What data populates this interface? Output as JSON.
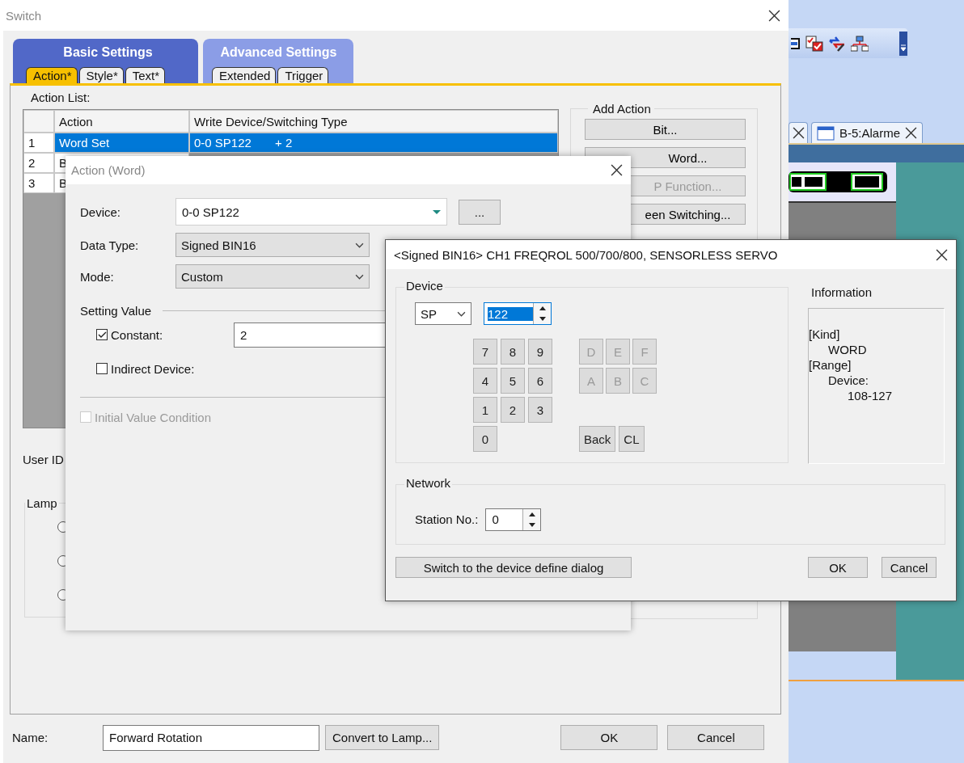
{
  "switch_window": {
    "title": "Switch",
    "tab_groups": [
      {
        "label": "Basic Settings",
        "selected": true,
        "tabs": [
          {
            "label": "Action*",
            "selected": true
          },
          {
            "label": "Style*",
            "selected": false
          },
          {
            "label": "Text*",
            "selected": false
          }
        ]
      },
      {
        "label": "Advanced Settings",
        "selected": false,
        "tabs": [
          {
            "label": "Extended",
            "selected": false
          },
          {
            "label": "Trigger",
            "selected": false
          }
        ]
      }
    ],
    "action_list": {
      "label": "Action List:",
      "columns": [
        "Action",
        "Write Device/Switching Type"
      ],
      "rows": [
        {
          "index": "1",
          "action": "Word Set",
          "target": "0-0 SP122       + 2",
          "selected": true
        },
        {
          "index": "2",
          "action": "B",
          "selected": false
        },
        {
          "index": "3",
          "action": "B",
          "selected": false
        }
      ]
    },
    "add_action": {
      "label": "Add Action",
      "buttons": [
        {
          "label": "Bit...",
          "disabled": false
        },
        {
          "label": "Word...",
          "disabled": false
        },
        {
          "label": "P Function...",
          "disabled": true
        },
        {
          "label": "een Switching...",
          "disabled": false
        }
      ]
    },
    "user_id_label": "User ID",
    "lamp_group": {
      "label": "Lamp"
    },
    "name": {
      "label": "Name:",
      "value": "Forward Rotation"
    },
    "buttons": [
      "Convert to Lamp...",
      "OK",
      "Cancel"
    ]
  },
  "action_dialog": {
    "title": "Action (Word)",
    "device": {
      "label": "Device:",
      "value": "0-0 SP122",
      "browse": "..."
    },
    "data_type": {
      "label": "Data Type:",
      "value": "Signed BIN16"
    },
    "mode": {
      "label": "Mode:",
      "value": "Custom"
    },
    "setting_value": {
      "label": "Setting Value",
      "options": [
        {
          "label": "Constant:",
          "checked": true,
          "value": "2"
        },
        {
          "label": "Indirect Device:",
          "checked": false
        }
      ]
    },
    "initial_value_condition": {
      "label": "Initial Value Condition",
      "checked": false,
      "disabled": true
    }
  },
  "device_dialog": {
    "title": "<Signed BIN16> CH1 FREQROL 500/700/800, SENSORLESS SERVO",
    "device_group": {
      "label": "Device",
      "device_type": "SP",
      "number": "122",
      "digit_keys": [
        "7",
        "8",
        "9",
        "4",
        "5",
        "6",
        "1",
        "2",
        "3",
        "0"
      ],
      "hex_keys": [
        {
          "label": "D",
          "disabled": true
        },
        {
          "label": "E",
          "disabled": true
        },
        {
          "label": "F",
          "disabled": true
        },
        {
          "label": "A",
          "disabled": true
        },
        {
          "label": "B",
          "disabled": true
        },
        {
          "label": "C",
          "disabled": true
        }
      ],
      "edit_keys": [
        "Back",
        "CL"
      ]
    },
    "information": {
      "label": "Information",
      "lines": [
        {
          "text": "[Kind]",
          "children": [
            {
              "text": "WORD"
            }
          ]
        },
        {
          "text": "[Range]",
          "children": [
            {
              "text": "Device:",
              "children": [
                {
                  "text": "108-127"
                }
              ]
            }
          ]
        }
      ]
    },
    "network": {
      "label": "Network",
      "station_label": "Station No.:",
      "station_value": "0"
    },
    "switch_button": "Switch to the device define dialog",
    "buttons": [
      "OK",
      "Cancel"
    ]
  },
  "background_app": {
    "tabs": [
      {
        "label": "B-5:Alarme"
      }
    ]
  }
}
